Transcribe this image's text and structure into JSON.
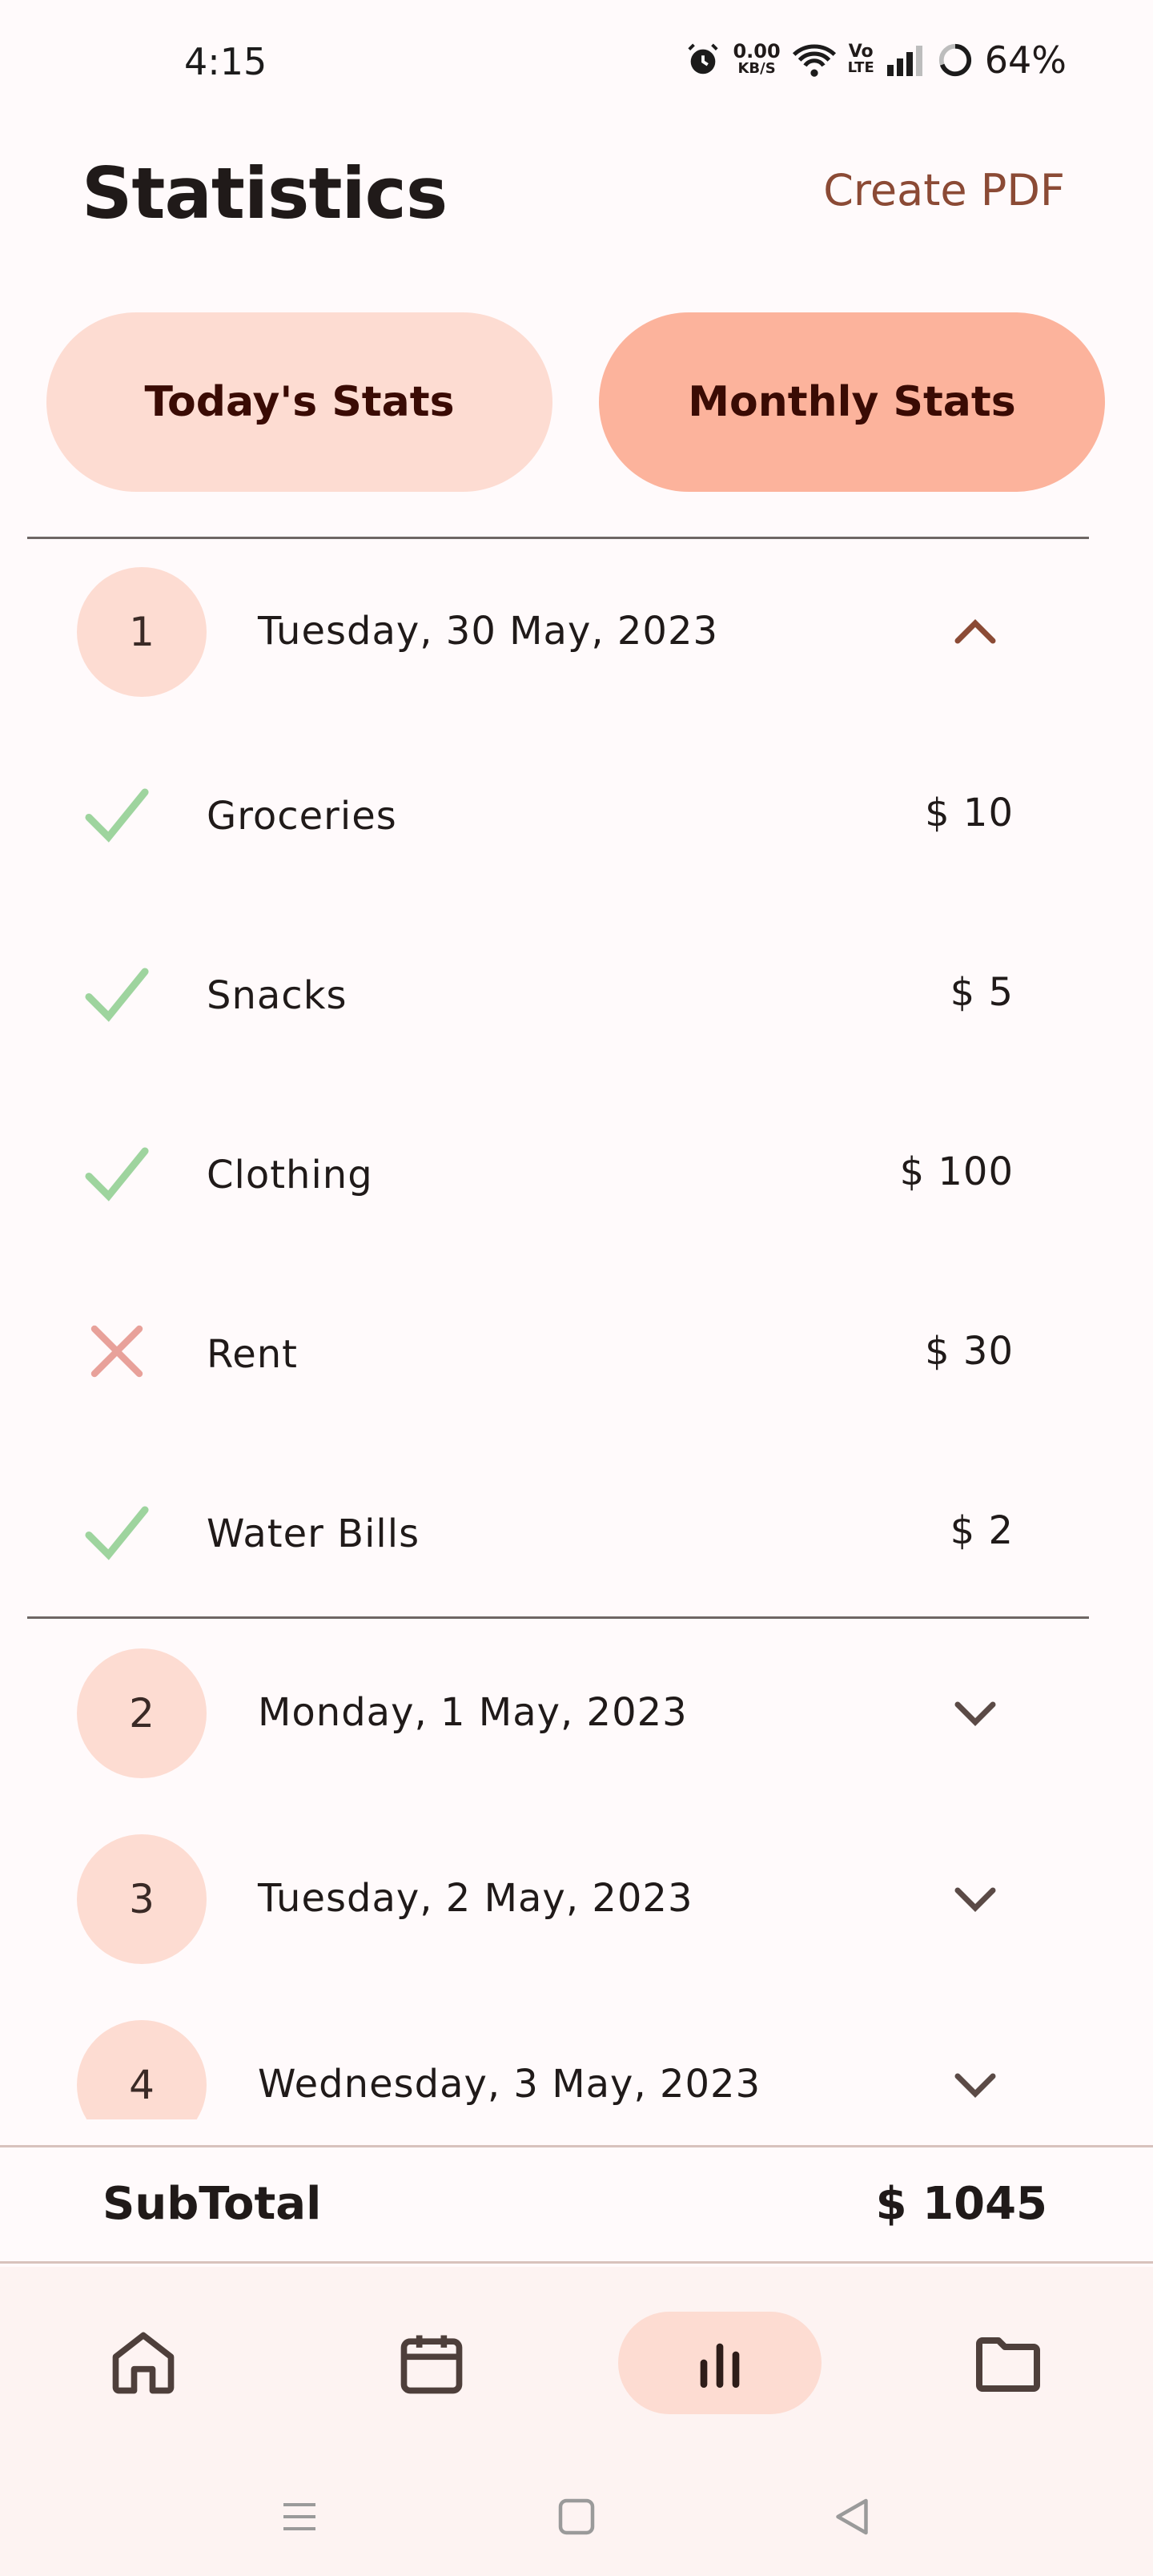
{
  "status_bar": {
    "time": "4:15",
    "net_speed_value": "0.00",
    "net_speed_unit": "KB/S",
    "network_type_top": "Vo",
    "network_type_bottom": "LTE",
    "battery": "64%"
  },
  "header": {
    "title": "Statistics",
    "create_pdf_label": "Create PDF"
  },
  "tabs": {
    "today_label": "Today's Stats",
    "monthly_label": "Monthly Stats",
    "selected": "Monthly Stats"
  },
  "days": [
    {
      "index": "1",
      "date": "Tuesday, 30 May, 2023",
      "expanded": true,
      "items": [
        {
          "label": "Groceries",
          "amount": "$  10",
          "status": "check-icon"
        },
        {
          "label": "Snacks",
          "amount": "$  5",
          "status": "check-icon"
        },
        {
          "label": "Clothing",
          "amount": "$  100",
          "status": "check-icon"
        },
        {
          "label": "Rent",
          "amount": "$  30",
          "status": "cross-icon"
        },
        {
          "label": "Water Bills",
          "amount": "$  2",
          "status": "check-icon"
        }
      ]
    },
    {
      "index": "2",
      "date": "Monday, 1 May, 2023",
      "expanded": false
    },
    {
      "index": "3",
      "date": "Tuesday, 2 May, 2023",
      "expanded": false
    },
    {
      "index": "4",
      "date": "Wednesday, 3 May, 2023",
      "expanded": false
    }
  ],
  "subtotal": {
    "label": "SubTotal",
    "value": "$ 1045"
  },
  "bottom_nav": {
    "items": [
      "home-icon",
      "calendar-icon",
      "bar-chart-icon",
      "folder-icon"
    ],
    "active": "bar-chart-icon"
  },
  "colors": {
    "accent_light": "#fddcd2",
    "accent": "#fcb39c",
    "check": "#9ed49e",
    "cross": "#e8a19a",
    "link": "#8b4a35"
  }
}
